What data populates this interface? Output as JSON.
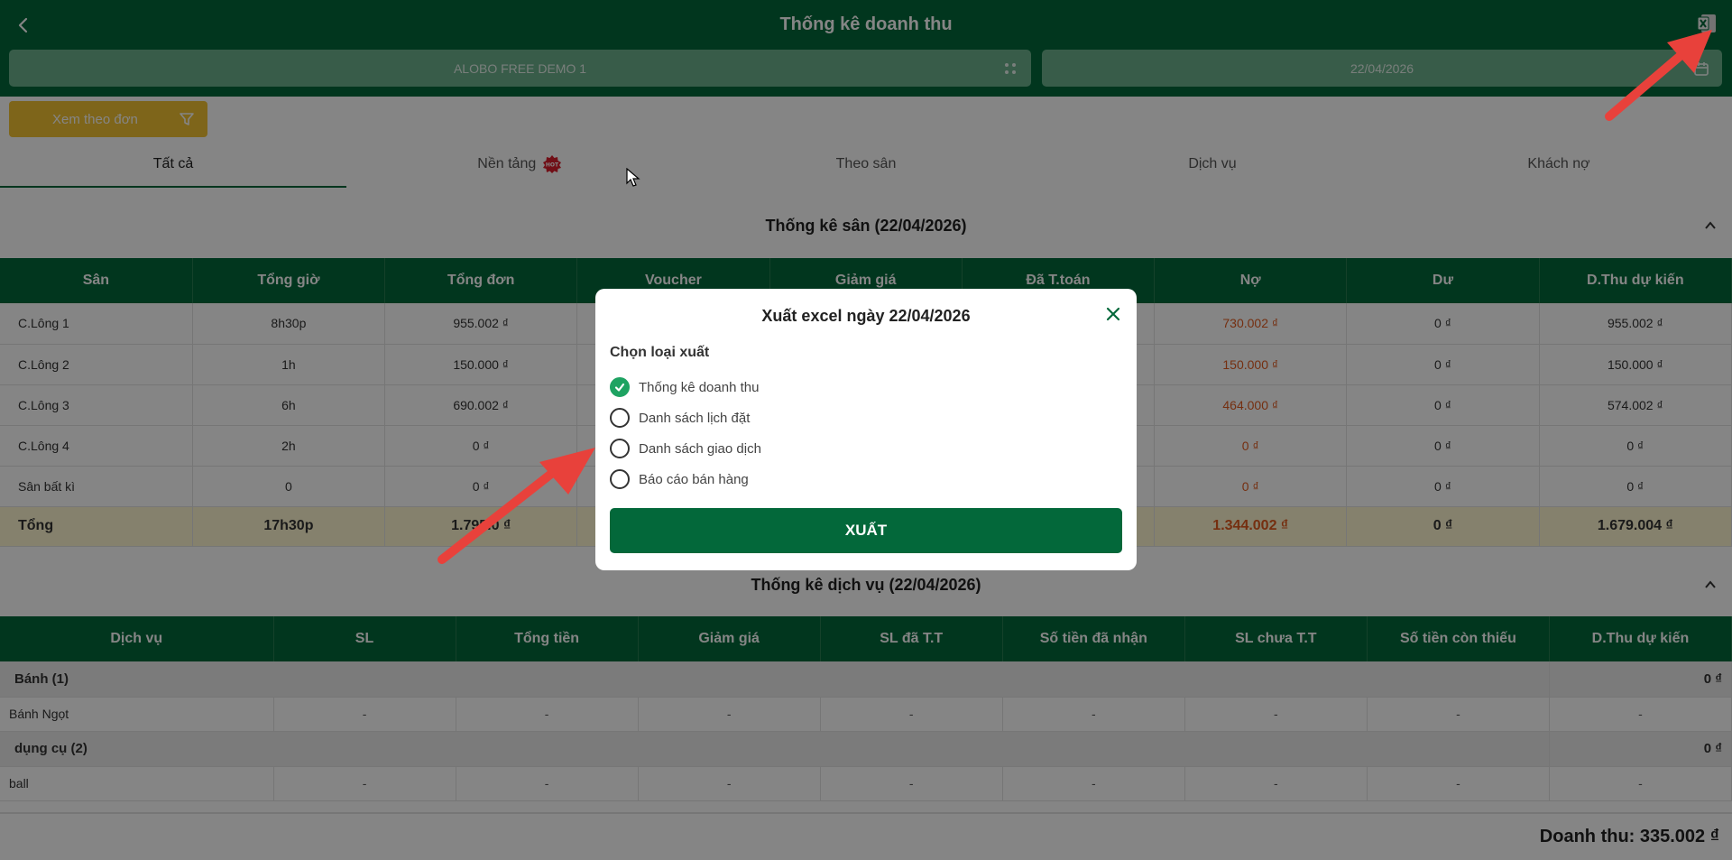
{
  "header": {
    "title": "Thống kê doanh thu",
    "venue": "ALOBO FREE DEMO 1",
    "date": "22/04/2026"
  },
  "filter_button": {
    "label": "Xem theo đơn"
  },
  "tabs": [
    {
      "label": "Tất cả",
      "active": true
    },
    {
      "label": "Nền tảng",
      "badge": "HOT"
    },
    {
      "label": "Theo sân"
    },
    {
      "label": "Dịch vụ"
    },
    {
      "label": "Khách nợ"
    }
  ],
  "court_stats": {
    "title": "Thống kê sân (22/04/2026)",
    "headers": [
      "Sân",
      "Tổng giờ",
      "Tổng đơn",
      "Voucher",
      "Giảm giá",
      "Đã T.toán",
      "Nợ",
      "Dư",
      "D.Thu dự kiến"
    ],
    "rows": [
      {
        "san": "C.Lông 1",
        "tong_gio": "8h30p",
        "tong_don": "955.002 ₫",
        "no": "730.002 ₫",
        "du": "0 ₫",
        "dthu": "955.002 ₫"
      },
      {
        "san": "C.Lông 2",
        "tong_gio": "1h",
        "tong_don": "150.000 ₫",
        "no": "150.000 ₫",
        "du": "0 ₫",
        "dthu": "150.000 ₫"
      },
      {
        "san": "C.Lông 3",
        "tong_gio": "6h",
        "tong_don": "690.002 ₫",
        "no": "464.000 ₫",
        "du": "0 ₫",
        "dthu": "574.002 ₫"
      },
      {
        "san": "C.Lông 4",
        "tong_gio": "2h",
        "tong_don": "0 ₫",
        "no": "0 ₫",
        "du": "0 ₫",
        "dthu": "0 ₫"
      },
      {
        "san": "Sân bất kì",
        "tong_gio": "0",
        "tong_don": "0 ₫",
        "no": "0 ₫",
        "du": "0 ₫",
        "dthu": "0 ₫"
      }
    ],
    "total": {
      "san": "Tổng",
      "tong_gio": "17h30p",
      "tong_don": "1.795.0",
      "tong_don_tail": "₫",
      "no": "1.344.002 ₫",
      "du": "0 ₫",
      "dthu": "1.679.004 ₫"
    }
  },
  "service_stats": {
    "title": "Thống kê dịch vụ (22/04/2026)",
    "headers": [
      "Dịch vụ",
      "SL",
      "Tổng tiền",
      "Giảm giá",
      "SL đã T.T",
      "Số tiền đã nhận",
      "SL chưa T.T",
      "Số tiền còn thiếu",
      "D.Thu dự kiến"
    ],
    "groups": [
      {
        "name": "Bánh (1)",
        "amount": "0 ₫",
        "items": [
          {
            "name": "Bánh Ngọt",
            "cells": [
              "-",
              "-",
              "-",
              "-",
              "-",
              "-",
              "-",
              "-"
            ]
          }
        ]
      },
      {
        "name": "dụng cụ (2)",
        "amount": "0 ₫",
        "items": [
          {
            "name": "ball",
            "cells": [
              "-",
              "-",
              "-",
              "-",
              "-",
              "-",
              "-",
              "-"
            ]
          }
        ]
      }
    ]
  },
  "footer": {
    "revenue": "Doanh thu: 335.002 ₫"
  },
  "modal": {
    "title": "Xuất excel ngày 22/04/2026",
    "label": "Chọn loại xuất",
    "options": [
      {
        "label": "Thống kê doanh thu",
        "checked": true
      },
      {
        "label": "Danh sách lịch đặt",
        "checked": false
      },
      {
        "label": "Danh sách giao dịch",
        "checked": false
      },
      {
        "label": "Báo cáo bán hàng",
        "checked": false
      }
    ],
    "export_label": "XUẤT"
  },
  "colors": {
    "primary": "#03683a",
    "accent": "#f1c232",
    "debt": "#e05a1f",
    "arrow": "#e8413b"
  }
}
